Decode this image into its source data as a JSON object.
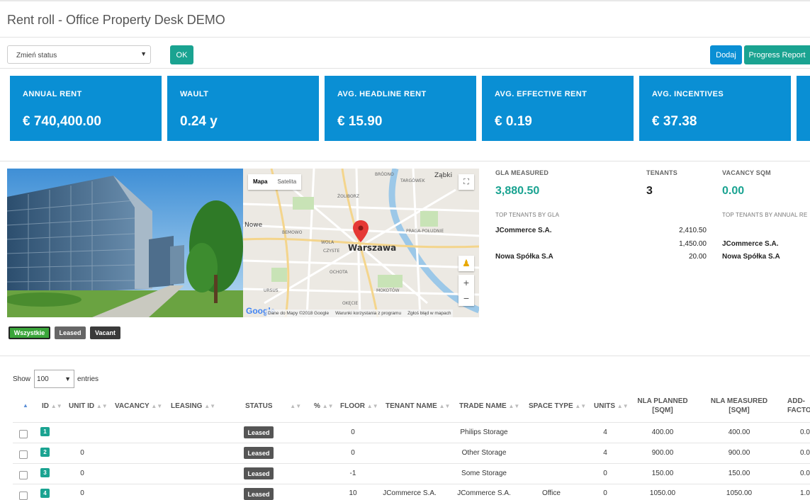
{
  "page": {
    "title": "Rent roll - Office Property Desk DEMO"
  },
  "toolbar": {
    "status_select": "Zmień status",
    "ok_label": "OK",
    "add_label": "Dodaj",
    "progress_label": "Progress Report"
  },
  "kpis": [
    {
      "label": "ANNUAL RENT",
      "value": "€ 740,400.00"
    },
    {
      "label": "WAULT",
      "value": "0.24 y"
    },
    {
      "label": "AVG. HEADLINE RENT",
      "value": "€ 15.90"
    },
    {
      "label": "AVG. EFFECTIVE RENT",
      "value": "€ 0.19"
    },
    {
      "label": "AVG. INCENTIVES",
      "value": "€ 37.38"
    }
  ],
  "map": {
    "tab_map": "Mapa",
    "tab_satellite": "Satelita",
    "city_label": "Warszawa",
    "districts": [
      "BRÓDNO",
      "TARGÓWEK",
      "ŻOLIBORZ",
      "Ząbki",
      "Nowe",
      "BEMOWO",
      "WOLA",
      "CZYSTE",
      "PRAGA-POŁUDNIE",
      "OCHOTA",
      "URSUS",
      "MOKOTÓW",
      "OKĘCIE"
    ],
    "attribution": "Dane do Mapy ©2018 Google",
    "terms": "Warunki korzystania z programu",
    "report": "Zgłoś błąd w mapach",
    "logo": "Google"
  },
  "stats": {
    "gla_label": "GLA MEASURED",
    "gla_value": "3,880.50",
    "tenants_label": "TENANTS",
    "tenants_value": "3",
    "vacancy_label": "VACANCY SQM",
    "vacancy_value": "0.00",
    "top_gla_label": "TOP TENANTS BY GLA",
    "top_rent_label": "TOP TENANTS BY ANNUAL RE",
    "top_gla": [
      {
        "name": "JCommerce S.A.",
        "value": "2,410.50"
      },
      {
        "name": "",
        "value": "1,450.00"
      },
      {
        "name": "Nowa Spółka S.A",
        "value": "20.00"
      }
    ],
    "top_rent": [
      "JCommerce S.A.",
      "Nowa Spółka S.A"
    ]
  },
  "filters": {
    "all": "Wszystkie",
    "leased": "Leased",
    "vacant": "Vacant"
  },
  "table": {
    "show_label": "Show",
    "page_size": "100",
    "entries_label": "entries",
    "headers": {
      "id": "ID",
      "unit_id": "UNIT ID",
      "vacancy": "VACANCY",
      "leasing": "LEASING",
      "status": "STATUS",
      "pct": "%",
      "floor": "FLOOR",
      "tenant": "TENANT NAME",
      "trade": "TRADE NAME",
      "space": "SPACE TYPE",
      "units": "UNITS",
      "nla_planned_1": "NLA PLANNED",
      "nla_planned_2": "[SQM]",
      "nla_measured_1": "NLA MEASURED",
      "nla_measured_2": "[SQM]",
      "add_1": "ADD-",
      "add_2": "FACTO"
    },
    "rows": [
      {
        "id": "1",
        "unit_id": "",
        "status": "Leased",
        "floor": "0",
        "tenant": "",
        "trade": "Philips Storage",
        "space": "",
        "units": "4",
        "planned": "400.00",
        "measured": "400.00",
        "add": "0.0"
      },
      {
        "id": "2",
        "unit_id": "0",
        "status": "Leased",
        "floor": "0",
        "tenant": "",
        "trade": "Other Storage",
        "space": "",
        "units": "4",
        "planned": "900.00",
        "measured": "900.00",
        "add": "0.0"
      },
      {
        "id": "3",
        "unit_id": "0",
        "status": "Leased",
        "floor": "-1",
        "tenant": "",
        "trade": "Some Storage",
        "space": "",
        "units": "0",
        "planned": "150.00",
        "measured": "150.00",
        "add": "0.0"
      },
      {
        "id": "4",
        "unit_id": "0",
        "status": "Leased",
        "floor": "10",
        "tenant": "JCommerce S.A.",
        "trade": "JCommerce S.A.",
        "space": "Office",
        "units": "0",
        "planned": "1050.00",
        "measured": "1050.00",
        "add": "1.0"
      }
    ]
  },
  "colors": {
    "primary": "#0a8fd4",
    "teal": "#1aa391",
    "filter_active": "#3aa63a",
    "badge_dark": "#555555"
  }
}
